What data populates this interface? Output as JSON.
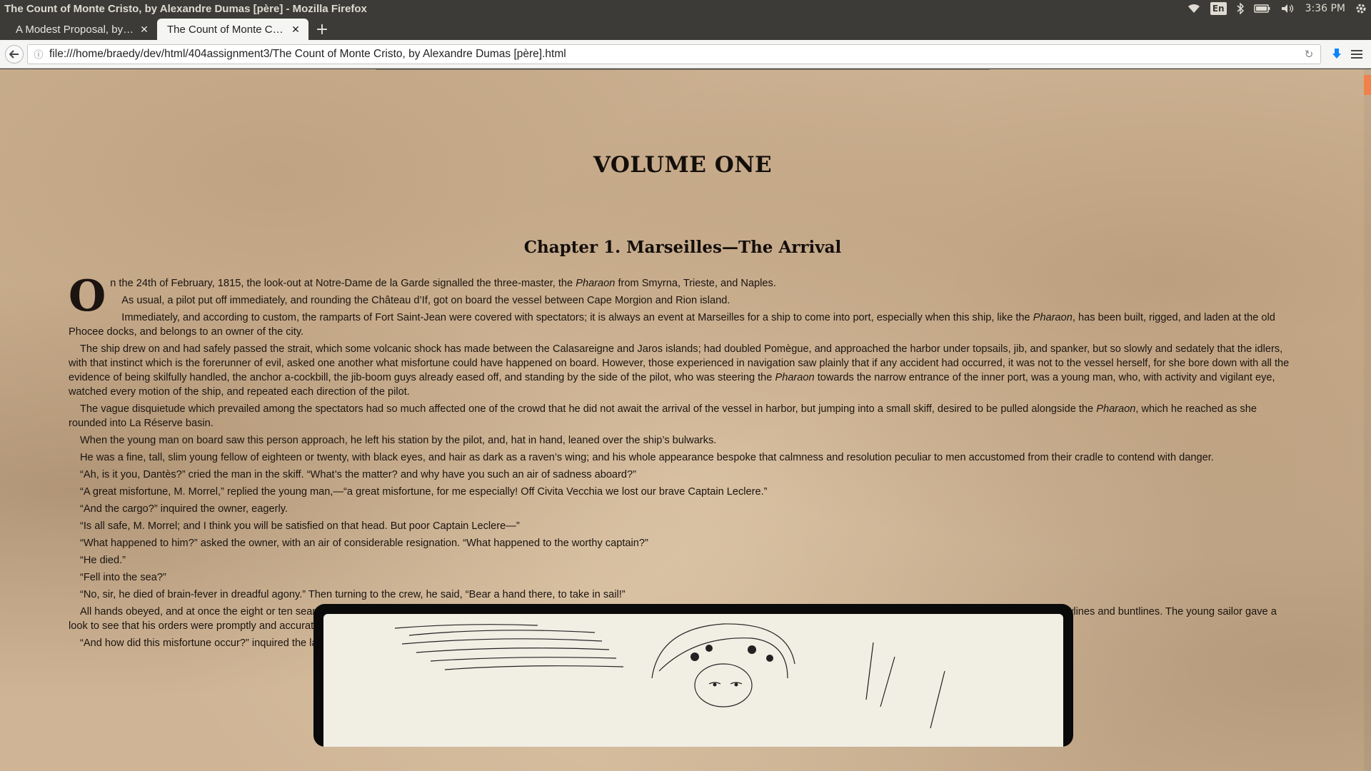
{
  "window_title": "The Count of Monte Cristo, by Alexandre Dumas [père] - Mozilla Firefox",
  "panel": {
    "keyboard_layout": "En",
    "clock": "3:36 PM"
  },
  "tabs": [
    {
      "label": "A Modest Proposal, by ...",
      "active": false
    },
    {
      "label": "The Count of Monte Cri...",
      "active": true
    }
  ],
  "url": "file:///home/braedy/dev/html/404assignment3/The Count of Monte Cristo, by Alexandre Dumas [père].html",
  "icons": {
    "back": "back-arrow-icon",
    "info": "info-icon",
    "reload": "reload-icon",
    "download": "download-icon",
    "menu": "hamburger-menu-icon"
  },
  "colors": {
    "page_background": "#cfb596",
    "text": "#1b1410",
    "accent_scroll": "#f0814a"
  },
  "content": {
    "volume_title": "VOLUME ONE",
    "chapter_title": "Chapter 1. Marseilles—The Arrival",
    "dropcap": "O",
    "p1": "n the 24th of February, 1815, the look-out at Notre-Dame de la Garde signalled the three-master, the ",
    "p1_em": "Pharaon",
    "p1_end": " from Smyrna, Trieste, and Naples.",
    "p2": "As usual, a pilot put off immediately, and rounding the Château d’If, got on board the vessel between Cape Morgion and Rion island.",
    "p3a": "Immediately, and according to custom, the ramparts of Fort Saint-Jean were covered with spectators; it is always an event at Marseilles for a ship to come into port, especially when this ship, like the ",
    "p3_em": "Pharaon",
    "p3b": ", has been built, rigged, and laden at the old Phocee docks, and belongs to an owner of the city.",
    "p4a": "The ship drew on and had safely passed the strait, which some volcanic shock has made between the Calasareigne and Jaros islands; had doubled Pomègue, and approached the harbor under topsails, jib, and spanker, but so slowly and sedately that the idlers, with that instinct which is the forerunner of evil, asked one another what misfortune could have happened on board. However, those experienced in navigation saw plainly that if any accident had occurred, it was not to the vessel herself, for she bore down with all the evidence of being skilfully handled, the anchor a-cockbill, the jib-boom guys already eased off, and standing by the side of the pilot, who was steering the ",
    "p4_em": "Pharaon",
    "p4b": " towards the narrow entrance of the inner port, was a young man, who, with activity and vigilant eye, watched every motion of the ship, and repeated each direction of the pilot.",
    "p5a": "The vague disquietude which prevailed among the spectators had so much affected one of the crowd that he did not await the arrival of the vessel in harbor, but jumping into a small skiff, desired to be pulled alongside the ",
    "p5_em": "Pharaon",
    "p5b": ", which he reached as she rounded into La Réserve basin.",
    "p6": "When the young man on board saw this person approach, he left his station by the pilot, and, hat in hand, leaned over the ship’s bulwarks.",
    "p7": "He was a fine, tall, slim young fellow of eighteen or twenty, with black eyes, and hair as dark as a raven’s wing; and his whole appearance bespoke that calmness and resolution peculiar to men accustomed from their cradle to contend with danger.",
    "p8": "“Ah, is it you, Dantès?” cried the man in the skiff. “What’s the matter? and why have you such an air of sadness aboard?”",
    "p9": "“A great misfortune, M. Morrel,” replied the young man,—“a great misfortune, for me especially! Off Civita Vecchia we lost our brave Captain Leclere.”",
    "p10": "“And the cargo?” inquired the owner, eagerly.",
    "p11": "“Is all safe, M. Morrel; and I think you will be satisfied on that head. But poor Captain Leclere—”",
    "p12": "“What happened to him?” asked the owner, with an air of considerable resignation. “What happened to the worthy captain?”",
    "p13": "“He died.”",
    "p14": "“Fell into the sea?”",
    "p15": "“No, sir, he died of brain-fever in dreadful agony.” Then turning to the crew, he said, “Bear a hand there, to take in sail!”",
    "p16": "All hands obeyed, and at once the eight or ten seamen who composed the crew, sprang to their respective stations at the spanker brails and outhaul, topsail sheets and halyards, the jib downhaul, and the topsail clewlines and buntlines. The young sailor gave a look to see that his orders were promptly and accurately obeyed, and then turned again to the owner.",
    "p17": "“And how did this misfortune occur?” inquired the latter, resuming the interrupted conversation."
  }
}
